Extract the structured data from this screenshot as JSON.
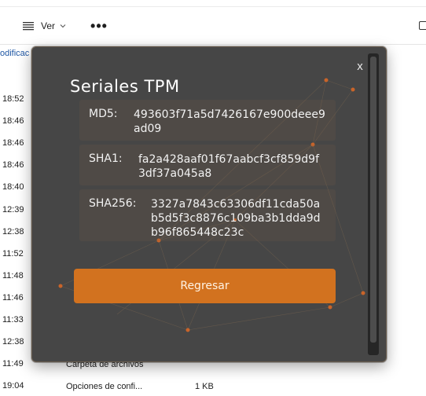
{
  "explorer": {
    "view_label": "Ver",
    "more_label": "•••",
    "column_header": "odificac",
    "times": [
      "18:52",
      "18:46",
      "18:46",
      "18:46",
      "18:40",
      "12:39",
      "12:38",
      "11:52",
      "11:48",
      "11:46",
      "11:33",
      "12:38",
      "11:49",
      "19:04"
    ],
    "rows_visible": [
      {
        "type": "Carpeta de archivos",
        "size": ""
      },
      {
        "type": "Opciones de confi...",
        "size": "1 KB"
      }
    ]
  },
  "dialog": {
    "title": "Seriales TPM",
    "close_label": "x",
    "hashes": [
      {
        "label": "MD5:",
        "value": "493603f71a5d7426167e900deee9ad09"
      },
      {
        "label": "SHA1:",
        "value": "fa2a428aaf01f67aabcf3cf859d9f3df37a045a8"
      },
      {
        "label": "SHA256:",
        "value": "3327a7843c63306df11cda50ab5d5f3c8876c109ba3b1dda9db96f865448c23c"
      }
    ],
    "back_button": "Regresar",
    "accent_color": "#d2721f",
    "background_color": "#464646"
  }
}
